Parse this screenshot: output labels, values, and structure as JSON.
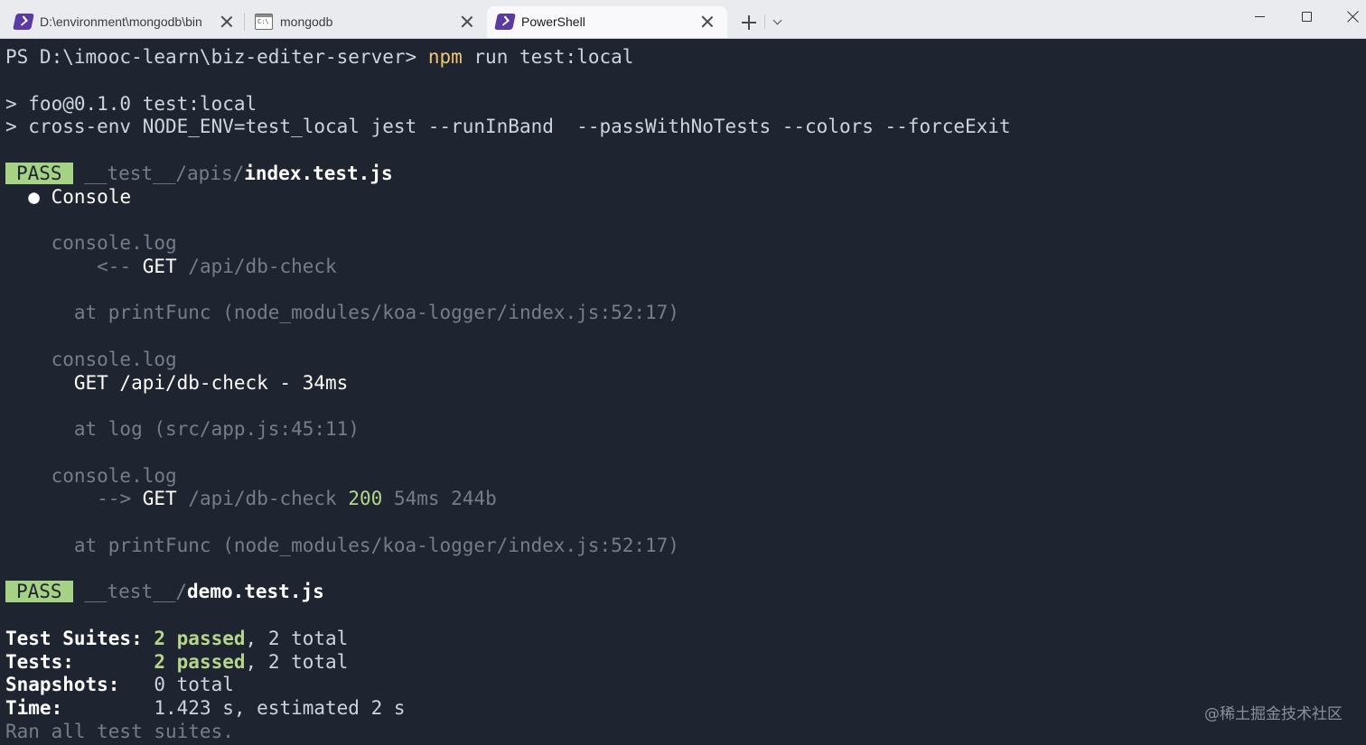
{
  "tabs": [
    {
      "title": "D:\\environment\\mongodb\\bin",
      "icon": "powershell-icon",
      "active": false
    },
    {
      "title": "mongodb",
      "icon": "cmd-icon",
      "active": false
    },
    {
      "title": "PowerShell",
      "icon": "powershell-icon",
      "active": true
    }
  ],
  "terminal": {
    "prompt": "PS D:\\imooc-learn\\biz-editer-server>",
    "command": "npm",
    "args": "run test:local",
    "script_header": "> foo@0.1.0 test:local",
    "script_cmd": "> cross-env NODE_ENV=test_local jest --runInBand  --passWithNoTests --colors --forceExit",
    "pass_label": "PASS",
    "suite1": {
      "dir": "__test__/apis/",
      "file": "index.test.js"
    },
    "console_heading": "Console",
    "bullet": "●",
    "logs": [
      {
        "label": "console.log",
        "arrow": "<--",
        "method": "GET",
        "path": "/api/db-check",
        "at": "at printFunc (node_modules/koa-logger/index.js:52:17)"
      },
      {
        "label": "console.log",
        "message": "GET /api/db-check - 34ms",
        "at": "at log (src/app.js:45:11)"
      },
      {
        "label": "console.log",
        "arrow": "-->",
        "method": "GET",
        "path": "/api/db-check",
        "status": "200",
        "extra": "54ms 244b",
        "at": "at printFunc (node_modules/koa-logger/index.js:52:17)"
      }
    ],
    "suite2": {
      "dir": "__test__/",
      "file": "demo.test.js"
    },
    "summary": {
      "suites_label": "Test Suites:",
      "suites_passed": "2 passed",
      "suites_total": ", 2 total",
      "tests_label": "Tests:",
      "tests_passed": "2 passed",
      "tests_total": ", 2 total",
      "snapshots_label": "Snapshots:",
      "snapshots_value": "0 total",
      "time_label": "Time:",
      "time_value": "1.423 s, estimated 2 s",
      "footer": "Ran all test suites."
    }
  },
  "watermark": "@稀土掘金技术社区"
}
